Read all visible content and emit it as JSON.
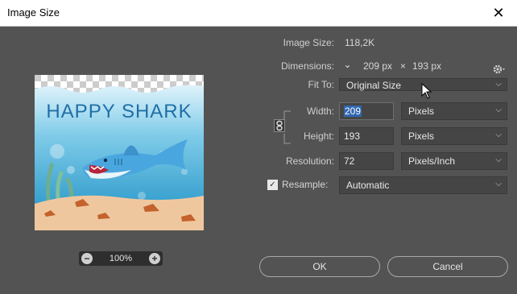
{
  "window": {
    "title": "Image Size",
    "close_glyph": "✕"
  },
  "image_size": {
    "label": "Image Size:",
    "value": "118,2K"
  },
  "dimensions": {
    "label": "Dimensions:",
    "width": "209 px",
    "times": "×",
    "height": "193 px"
  },
  "fit_to": {
    "label": "Fit To:",
    "value": "Original Size"
  },
  "width": {
    "label": "Width:",
    "value": "209",
    "unit": "Pixels"
  },
  "height": {
    "label": "Height:",
    "value": "193",
    "unit": "Pixels"
  },
  "resolution": {
    "label": "Resolution:",
    "value": "72",
    "unit": "Pixels/Inch"
  },
  "resample": {
    "label": "Resample:",
    "checked": true,
    "value": "Automatic"
  },
  "preview": {
    "title": "HAPPY SHARK",
    "zoom": "100%",
    "minus": "−",
    "plus": "+"
  },
  "buttons": {
    "ok": "OK",
    "cancel": "Cancel"
  },
  "icons": {
    "gear": "gear-icon",
    "chevron": "chevron-down-icon",
    "link": "chain-link-icon"
  },
  "colors": {
    "dialog_bg": "#535353",
    "field_bg": "#454545",
    "selection": "#3167b0"
  }
}
